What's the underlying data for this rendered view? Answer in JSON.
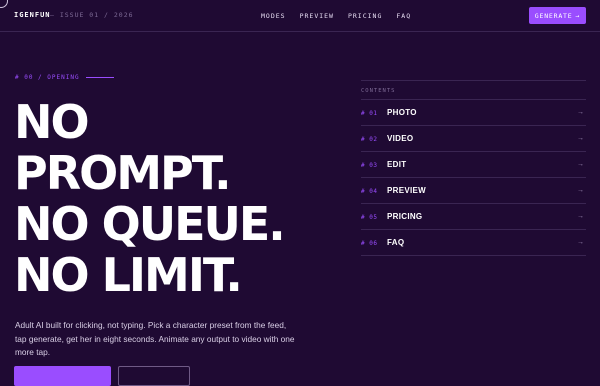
{
  "nav": {
    "brand": "IGENFUN",
    "issue": "— ISSUE 01 / 2026",
    "links": [
      "MODES",
      "PREVIEW",
      "PRICING",
      "FAQ"
    ],
    "cta_label": "GENERATE",
    "cta_arrow": "→"
  },
  "hero": {
    "eyebrow": "# 00 / OPENING",
    "headline_lines": [
      "NO",
      "PROMPT.",
      "NO QUEUE.",
      "NO LIMIT."
    ],
    "description": "Adult AI built for clicking, not typing. Pick a character preset from the feed, tap generate, get her in eight seconds. Animate any output to video with one more tap."
  },
  "contents": {
    "title": "CONTENTS",
    "items": [
      {
        "num": "# 01",
        "label": "PHOTO",
        "arrow": "→"
      },
      {
        "num": "# 02",
        "label": "VIDEO",
        "arrow": "→"
      },
      {
        "num": "# 03",
        "label": "EDIT",
        "arrow": "→"
      },
      {
        "num": "# 04",
        "label": "PREVIEW",
        "arrow": "→"
      },
      {
        "num": "# 05",
        "label": "PRICING",
        "arrow": "→"
      },
      {
        "num": "# 06",
        "label": "FAQ",
        "arrow": "→"
      }
    ]
  },
  "colors": {
    "background": "#1f0a33",
    "accent": "#9a4dff",
    "text": "#ffffff"
  }
}
